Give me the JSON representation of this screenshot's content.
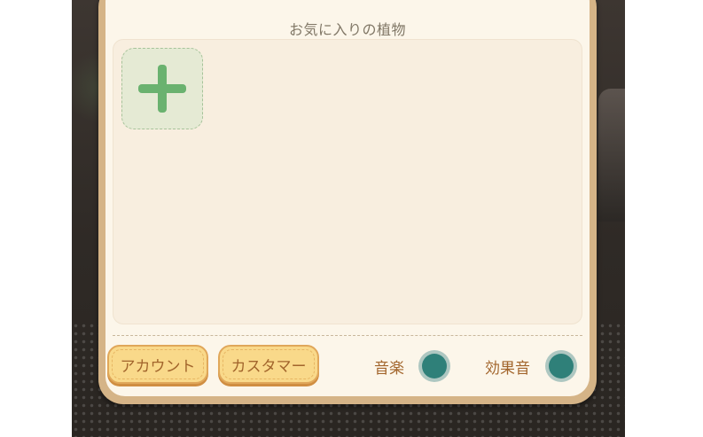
{
  "favorites_title": "お気に入りの植物",
  "add_slot_icon": "plus-icon",
  "buttons": {
    "account_label": "アカウント",
    "customer_label": "カスタマー"
  },
  "toggles": {
    "music_label": "音楽",
    "sfx_label": "効果音"
  },
  "colors": {
    "panel_frame": "#d5b487",
    "panel_bg": "#fcf6ea",
    "accent_green": "#6ab26f",
    "button_fill": "#f9d98a",
    "button_text": "#a2652c",
    "toggle_color": "#2f8079"
  }
}
